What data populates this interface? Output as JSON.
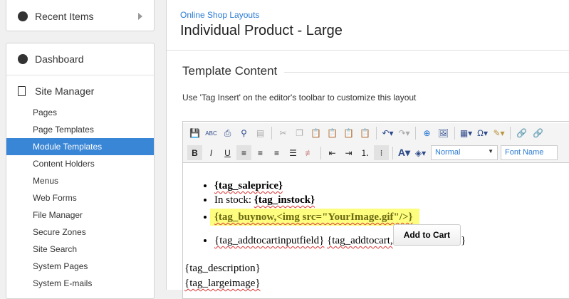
{
  "sidebar": {
    "recent": "Recent Items",
    "dashboard": "Dashboard",
    "site_manager": "Site Manager",
    "items": [
      "Pages",
      "Page Templates",
      "Module Templates",
      "Content Holders",
      "Menus",
      "Web Forms",
      "File Manager",
      "Secure Zones",
      "Site Search",
      "System Pages",
      "System E-mails"
    ],
    "active": "Module Templates"
  },
  "main": {
    "breadcrumb": "Online Shop Layouts",
    "title": "Individual Product - Large",
    "section": "Template Content",
    "description": "Use 'Tag Insert' on the editor's toolbar to customize this layout"
  },
  "editor": {
    "format_select": "Normal",
    "font_select": "Font Name",
    "list": {
      "saleprice": "{tag_saleprice}",
      "instock_label": "In stock: ",
      "instock": "{tag_instock}",
      "buynow": "{tag_buynow,<img src=\"YourImage.gif\"/>}",
      "addtocart_field": "{tag_addtocartinputfield}",
      "addtocart": "{tag_addtocart,",
      "addtocart_close": "}",
      "cart_button": "Add to Cart"
    },
    "lines": [
      "{tag_description}",
      "{tag_largeimage}"
    ]
  }
}
